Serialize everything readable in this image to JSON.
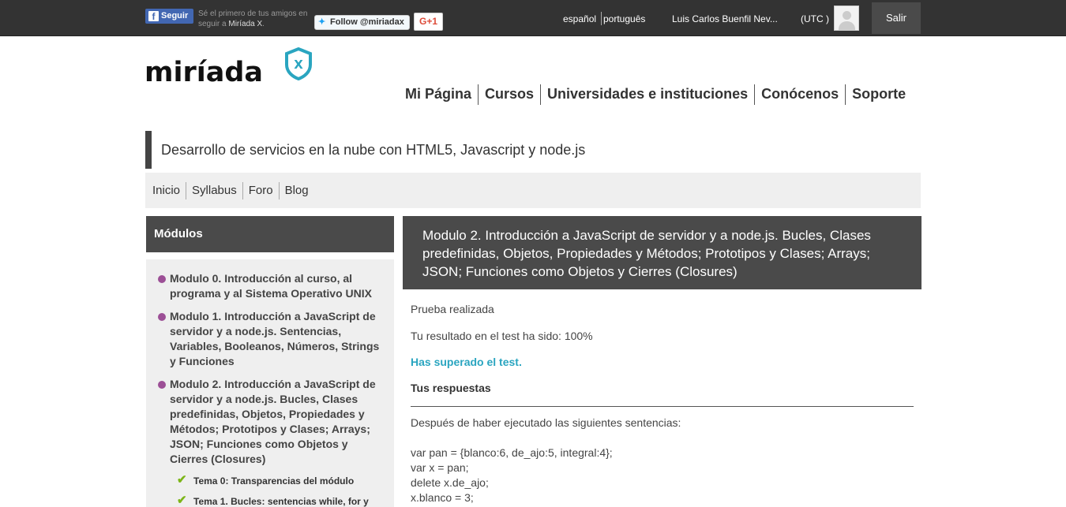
{
  "topbar": {
    "facebook_follow": "Seguir",
    "facebook_note_prefix": "Sé el primero de tus amigos en seguir a",
    "facebook_note_brand": "Miríada X",
    "twitter_follow": "Follow @miriadax",
    "gplus": "G+1",
    "lang_es": "español",
    "lang_pt": "português",
    "user_name": "Luis Carlos Buenfil Nev...",
    "timezone": "(UTC )",
    "logout": "Salir"
  },
  "header": {
    "logo": "miríada",
    "logo_badge": "X",
    "nav": [
      "Mi Página",
      "Cursos",
      "Universidades e instituciones",
      "Conócenos",
      "Soporte"
    ]
  },
  "course": {
    "title": "Desarrollo de servicios en la nube con HTML5, Javascript y node.js",
    "tabs": [
      "Inicio",
      "Syllabus",
      "Foro",
      "Blog"
    ]
  },
  "sidebar": {
    "title": "Módulos",
    "modules": [
      "Modulo 0. Introducción al curso, al programa y al Sistema Operativo UNIX",
      "Modulo 1. Introducción a JavaScript de servidor y a node.js. Sentencias, Variables, Booleanos, Números, Strings y Funciones",
      "Modulo 2. Introducción a JavaScript de servidor y a node.js. Bucles, Clases predefinidas, Objetos, Propiedades y Métodos; Prototipos y Clases; Arrays; JSON; Funciones como Objetos y Cierres (Closures)"
    ],
    "topics": [
      "Tema 0: Transparencias del módulo",
      "Tema 1. Bucles: sentencias while, for y"
    ]
  },
  "main": {
    "heading": "Modulo 2. Introducción a JavaScript de servidor y a node.js. Bucles, Clases predefinidas, Objetos, Propiedades y Métodos; Prototipos y Clases; Arrays; JSON; Funciones como Objetos y Cierres (Closures)",
    "status": "Prueba realizada",
    "result": "Tu resultado en el test ha sido: 100%",
    "passed": "Has superado el test.",
    "answers_title": "Tus respuestas",
    "question_intro": "Después de haber ejecutado las siguientes sentencias:",
    "code": [
      "var pan = {blanco:6, de_ajo:5, integral:4};",
      "var x = pan;",
      "delete x.de_ajo;",
      "x.blanco = 3;"
    ]
  }
}
